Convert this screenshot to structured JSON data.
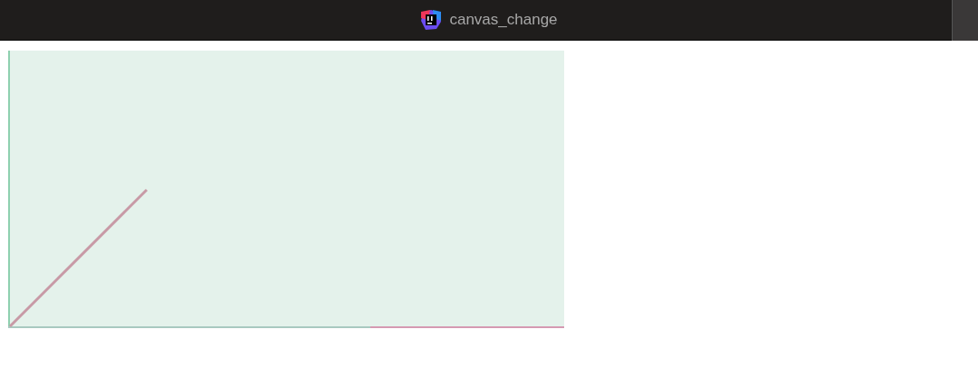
{
  "window": {
    "title": "canvas_change"
  }
}
